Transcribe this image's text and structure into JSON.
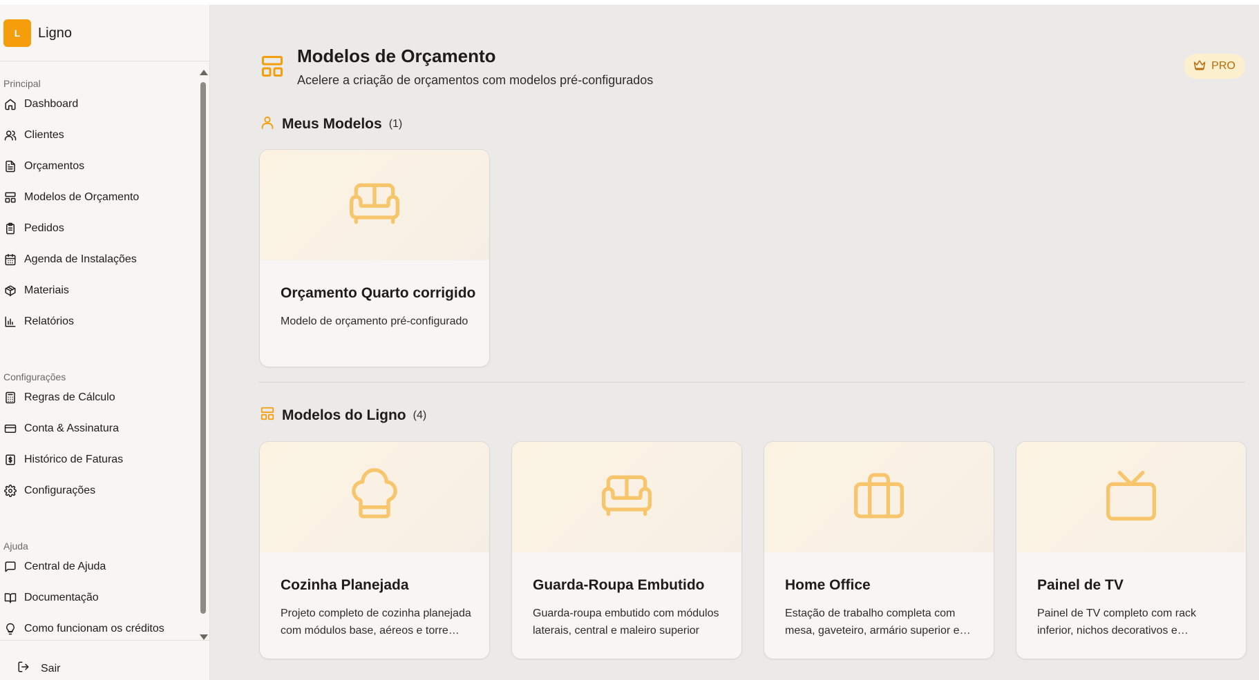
{
  "app": {
    "logo_letter": "L",
    "name": "Ligno"
  },
  "sidebar": {
    "sections": [
      {
        "label": "Principal"
      },
      {
        "label": "Configurações"
      },
      {
        "label": "Ajuda"
      }
    ],
    "items": [
      {
        "label": "Dashboard",
        "icon": "home-icon"
      },
      {
        "label": "Clientes",
        "icon": "users-icon"
      },
      {
        "label": "Orçamentos",
        "icon": "file-text-icon"
      },
      {
        "label": "Modelos de Orçamento",
        "icon": "layout-icon"
      },
      {
        "label": "Pedidos",
        "icon": "clipboard-icon"
      },
      {
        "label": "Agenda de Instalações",
        "icon": "calendar-icon"
      },
      {
        "label": "Materiais",
        "icon": "package-icon"
      },
      {
        "label": "Relatórios",
        "icon": "bar-chart-icon"
      },
      {
        "label": "Regras de Cálculo",
        "icon": "calculator-icon"
      },
      {
        "label": "Conta & Assinatura",
        "icon": "credit-card-icon"
      },
      {
        "label": "Histórico de Faturas",
        "icon": "receipt-icon"
      },
      {
        "label": "Configurações",
        "icon": "gear-icon"
      },
      {
        "label": "Central de Ajuda",
        "icon": "message-square-icon"
      },
      {
        "label": "Documentação",
        "icon": "book-open-icon"
      },
      {
        "label": "Como funcionam os créditos",
        "icon": "lightbulb-icon"
      }
    ],
    "logout_label": "Sair"
  },
  "header": {
    "title": "Modelos de Orçamento",
    "subtitle": "Acelere a criação de orçamentos com modelos pré-configurados",
    "badge": "PRO"
  },
  "my_models": {
    "title": "Meus Modelos",
    "count": "(1)",
    "cards": [
      {
        "title": "Orçamento Quarto corrigido",
        "description": "Modelo de orçamento pré-configurado",
        "icon": "sofa-icon"
      }
    ]
  },
  "ligno_models": {
    "title": "Modelos do Ligno",
    "count": "(4)",
    "cards": [
      {
        "title": "Cozinha Planejada",
        "description": "Projeto completo de cozinha planejada com módulos base, aéreos e torre quente",
        "icon": "chef-hat-icon"
      },
      {
        "title": "Guarda-Roupa Embutido",
        "description": "Guarda-roupa embutido com módulos laterais, central e maleiro superior",
        "icon": "sofa-icon"
      },
      {
        "title": "Home Office",
        "description": "Estação de trabalho completa com mesa, gaveteiro, armário superior e prateleiras",
        "icon": "briefcase-icon"
      },
      {
        "title": "Painel de TV",
        "description": "Painel de TV completo com rack inferior, nichos decorativos e iluminação",
        "icon": "tv-icon"
      }
    ]
  },
  "colors": {
    "accent": "#f59e0b",
    "accent_icon": "#f7c56b",
    "badge_bg": "#fdf0cf",
    "badge_text": "#b76a0a"
  }
}
